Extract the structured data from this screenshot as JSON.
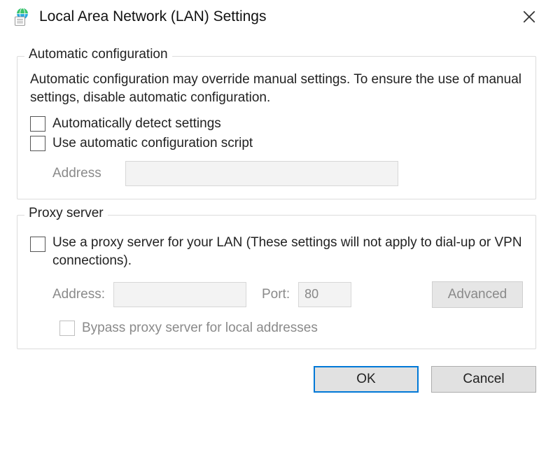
{
  "title": "Local Area Network (LAN) Settings",
  "auto": {
    "legend": "Automatic configuration",
    "desc": "Automatic configuration may override manual settings.  To ensure the use of manual settings, disable automatic configuration.",
    "detect_label": "Automatically detect settings",
    "script_label": "Use automatic configuration script",
    "address_label": "Address",
    "address_value": ""
  },
  "proxy": {
    "legend": "Proxy server",
    "use_label": "Use a proxy server for your LAN (These settings will not apply to dial-up or VPN connections).",
    "address_label": "Address:",
    "address_value": "",
    "port_label": "Port:",
    "port_value": "80",
    "advanced_label": "Advanced",
    "bypass_label": "Bypass proxy server for local addresses"
  },
  "buttons": {
    "ok": "OK",
    "cancel": "Cancel"
  }
}
